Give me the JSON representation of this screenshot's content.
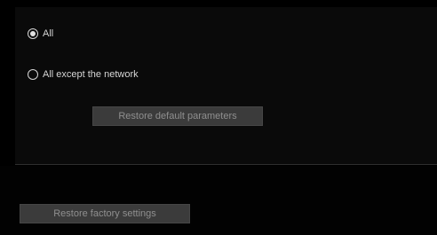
{
  "restore_options": {
    "items": [
      {
        "label": "All",
        "selected": true
      },
      {
        "label": "All except the network",
        "selected": false
      }
    ],
    "restore_default_label": "Restore default parameters"
  },
  "factory": {
    "restore_factory_label": "Restore factory settings"
  },
  "colors": {
    "background": "#000000",
    "button_fill": "#3b3b3b",
    "button_text": "#8f8f8f",
    "label_text": "#d6d6d6"
  }
}
